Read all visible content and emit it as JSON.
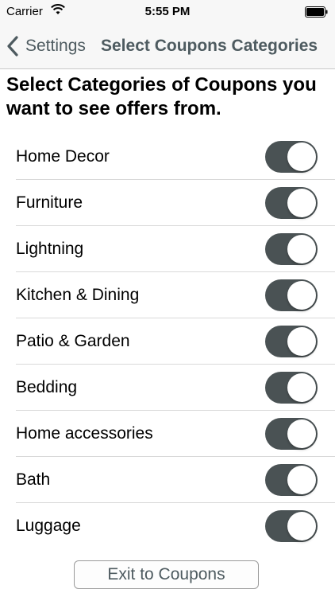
{
  "status_bar": {
    "carrier": "Carrier",
    "time": "5:55 PM",
    "wifi_icon": "wifi-icon",
    "battery_icon": "battery-full-icon"
  },
  "nav": {
    "back_label": "Settings",
    "back_icon": "chevron-left-icon",
    "title": "Select Coupons Categories"
  },
  "heading": "Select Categories of Coupons you want to see offers from.",
  "categories": [
    {
      "label": "Home Decor",
      "enabled": true
    },
    {
      "label": "Furniture",
      "enabled": true
    },
    {
      "label": "Lightning",
      "enabled": true
    },
    {
      "label": "Kitchen & Dining",
      "enabled": true
    },
    {
      "label": "Patio & Garden",
      "enabled": true
    },
    {
      "label": "Bedding",
      "enabled": true
    },
    {
      "label": "Home accessories",
      "enabled": true
    },
    {
      "label": "Bath",
      "enabled": true
    },
    {
      "label": "Luggage",
      "enabled": true
    }
  ],
  "exit_button_label": "Exit to Coupons",
  "colors": {
    "toggle_on": "#4a5254",
    "nav_text": "#4e5b60",
    "bar_background": "#f7f7f7"
  }
}
